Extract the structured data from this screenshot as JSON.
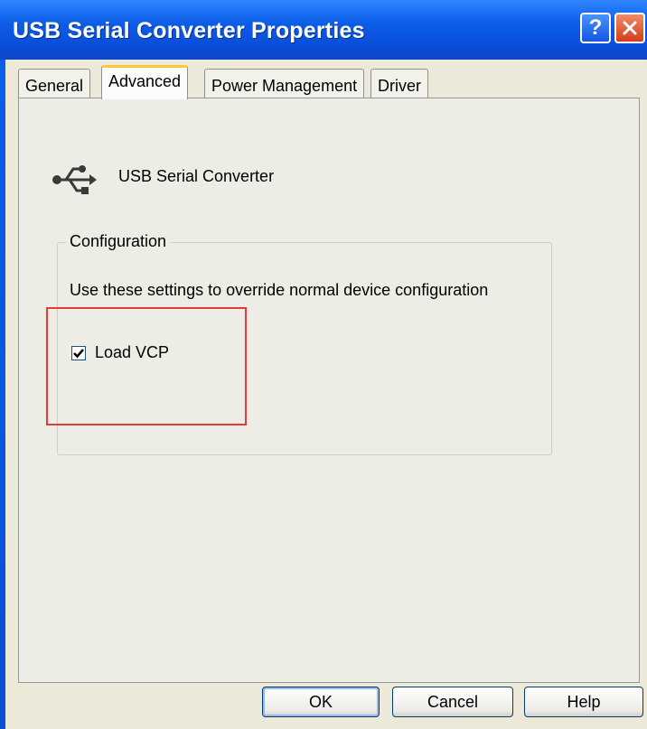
{
  "window": {
    "title": "USB Serial Converter Properties",
    "help_label": "?",
    "close_icon": "close-icon"
  },
  "tabs": [
    {
      "label": "General",
      "active": false
    },
    {
      "label": "Advanced",
      "active": true
    },
    {
      "label": "Power Management",
      "active": false
    },
    {
      "label": "Driver",
      "active": false
    }
  ],
  "device": {
    "icon": "usb-icon",
    "name": "USB Serial Converter"
  },
  "configuration": {
    "label": "Configuration",
    "description": "Use these settings to override normal device configuration",
    "load_vcp": {
      "label": "Load VCP",
      "checked": true
    }
  },
  "buttons": {
    "ok": "OK",
    "cancel": "Cancel",
    "help": "Help"
  },
  "colors": {
    "titlebar": "#0a4ed8",
    "highlight": "#e53a3a",
    "active_tab_accent": "#ffc83c"
  }
}
